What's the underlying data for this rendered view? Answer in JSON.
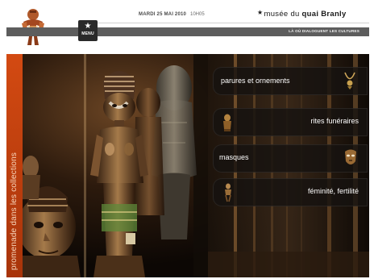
{
  "header": {
    "date": "MARDI 25 MAI 2010",
    "time": "10H05",
    "brand": {
      "star": "★",
      "prefix": "musée du ",
      "bold": "quai Branly"
    },
    "tagline": "LÀ OÙ DIALOGUENT LES CULTURES",
    "menu": {
      "icon": "star-icon",
      "glyph": "★",
      "label": "MENU"
    },
    "logo_icon": "statue-figure-icon"
  },
  "sidebar": {
    "vertical_label": "promenade dans les collections",
    "color": "#c8400e"
  },
  "menu_tiles": [
    {
      "label": "parures et ornements",
      "icon": "necklace-ornament-icon"
    },
    {
      "label": "rites funéraires",
      "icon": "funerary-figure-icon"
    },
    {
      "label": "masques",
      "icon": "mask-icon"
    },
    {
      "label": "féminité, fertilité",
      "icon": "fertility-figure-icon"
    }
  ],
  "colors": {
    "accent": "#c8400e",
    "header_bar": "#5d5d5d",
    "tile_bg": "#1f1a17"
  }
}
